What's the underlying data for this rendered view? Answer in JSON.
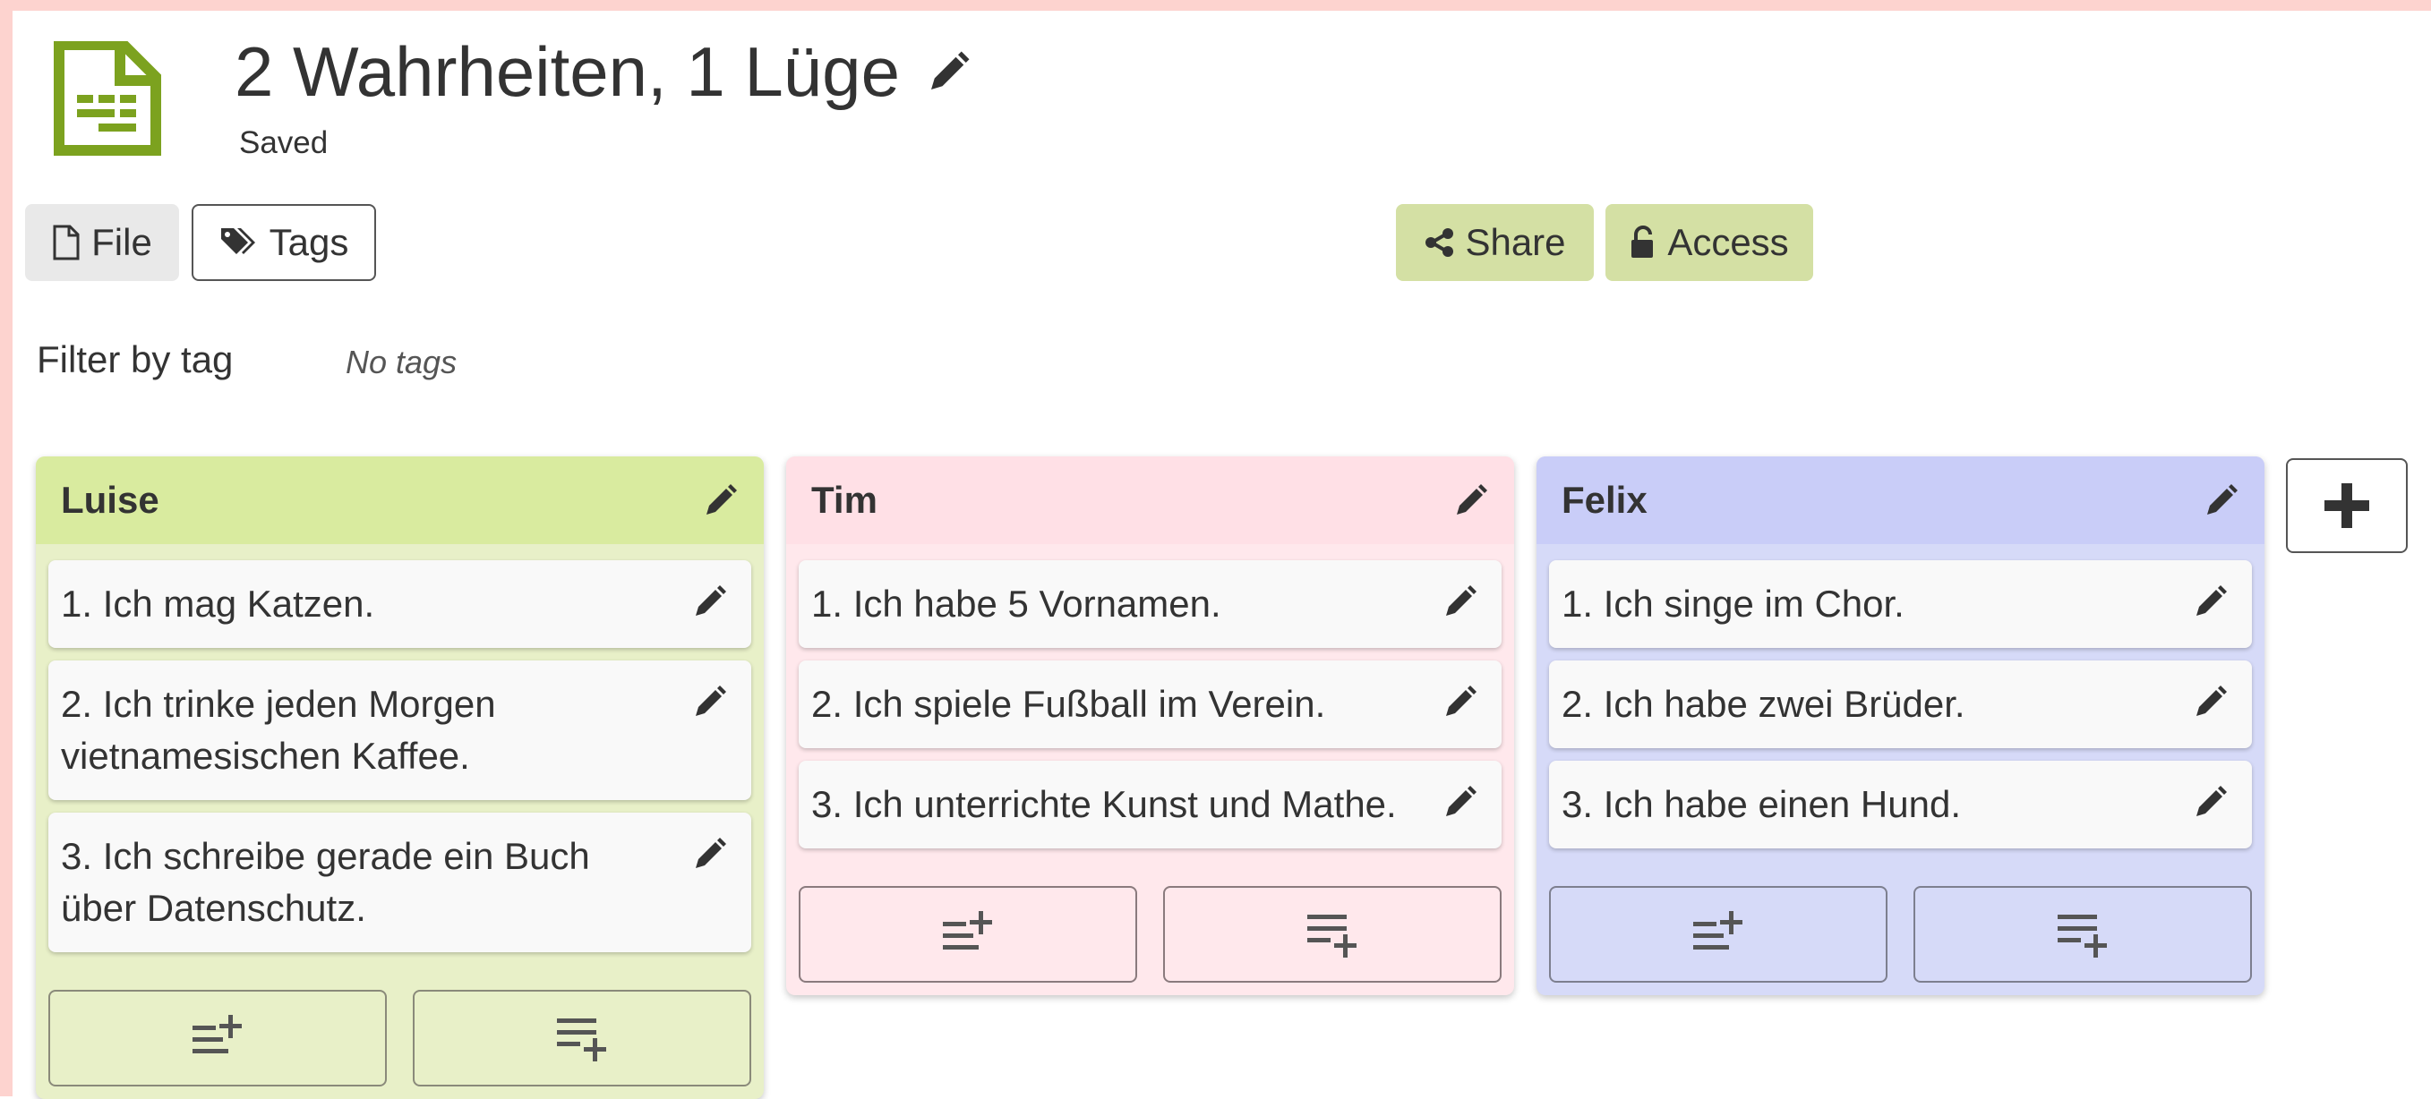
{
  "document": {
    "title": "2 Wahrheiten, 1 Lüge",
    "status": "Saved",
    "icon": "spreadsheet-file-icon"
  },
  "toolbar": {
    "file_label": "File",
    "tags_label": "Tags",
    "share_label": "Share",
    "access_label": "Access"
  },
  "filter": {
    "label": "Filter by tag",
    "value": "No tags"
  },
  "colors": {
    "accent_green": "#7ca21f",
    "button_green": "#d4e0a4",
    "frame_pink": "#fdd3cf"
  },
  "columns": [
    {
      "title": "Luise",
      "color": "#d9eb9f",
      "cards": [
        "1. Ich mag Katzen.",
        "2. Ich trinke jeden Morgen vietnamesischen Kaffee.",
        "3. Ich schreibe gerade ein Buch über Datenschutz."
      ]
    },
    {
      "title": "Tim",
      "color": "#ffe0e6",
      "cards": [
        "1. Ich habe 5 Vornamen.",
        "2. Ich spiele Fußball im Verein.",
        "3. Ich unterrichte Kunst und Mathe."
      ]
    },
    {
      "title": "Felix",
      "color": "#c9cdf8",
      "cards": [
        "1. Ich singe im Chor.",
        "2. Ich habe zwei Brüder.",
        "3. Ich habe einen Hund."
      ]
    }
  ]
}
